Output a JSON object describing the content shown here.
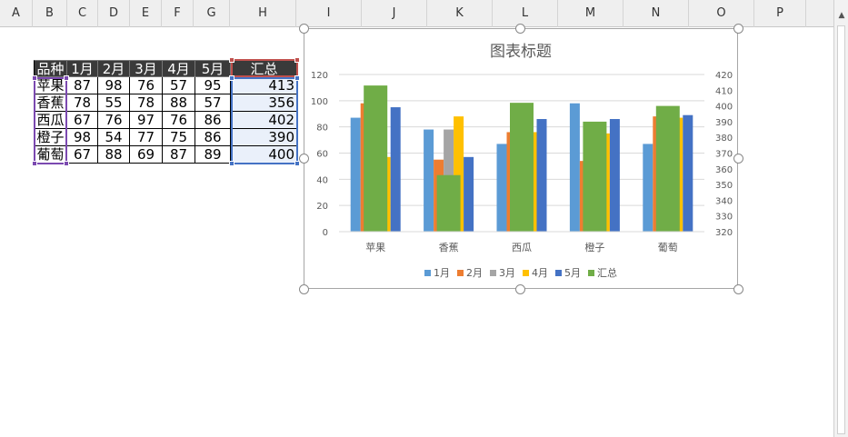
{
  "columns": [
    "A",
    "B",
    "C",
    "D",
    "E",
    "F",
    "G",
    "H",
    "I",
    "J",
    "K",
    "L",
    "M",
    "N",
    "O",
    "P"
  ],
  "table": {
    "headers": [
      "品种",
      "1月",
      "2月",
      "3月",
      "4月",
      "5月",
      "汇总"
    ],
    "rows": [
      {
        "name": "苹果",
        "values": [
          87,
          98,
          76,
          57,
          95
        ],
        "total": 413
      },
      {
        "name": "香蕉",
        "values": [
          78,
          55,
          78,
          88,
          57
        ],
        "total": 356
      },
      {
        "name": "西瓜",
        "values": [
          67,
          76,
          97,
          76,
          86
        ],
        "total": 402
      },
      {
        "name": "橙子",
        "values": [
          98,
          54,
          77,
          75,
          86
        ],
        "total": 390
      },
      {
        "name": "葡萄",
        "values": [
          67,
          88,
          69,
          87,
          89
        ],
        "total": 400
      }
    ]
  },
  "chart_data": {
    "type": "bar",
    "title": "图表标题",
    "categories": [
      "苹果",
      "香蕉",
      "西瓜",
      "橙子",
      "葡萄"
    ],
    "series": [
      {
        "name": "1月",
        "axis": "primary",
        "color": "#5b9bd5",
        "values": [
          87,
          78,
          67,
          98,
          67
        ]
      },
      {
        "name": "2月",
        "axis": "primary",
        "color": "#ed7d31",
        "values": [
          98,
          55,
          76,
          54,
          88
        ]
      },
      {
        "name": "3月",
        "axis": "primary",
        "color": "#a5a5a5",
        "values": [
          76,
          78,
          97,
          77,
          69
        ]
      },
      {
        "name": "4月",
        "axis": "primary",
        "color": "#ffc000",
        "values": [
          57,
          88,
          76,
          75,
          87
        ]
      },
      {
        "name": "5月",
        "axis": "primary",
        "color": "#4472c4",
        "values": [
          95,
          57,
          86,
          86,
          89
        ]
      },
      {
        "name": "汇总",
        "axis": "secondary",
        "color": "#70ad47",
        "values": [
          413,
          356,
          402,
          390,
          400
        ]
      }
    ],
    "ylim": [
      0,
      120
    ],
    "yticks": [
      "0",
      "20",
      "40",
      "60",
      "80",
      "100",
      "120"
    ],
    "y2lim": [
      320,
      420
    ],
    "y2ticks": [
      "320",
      "330",
      "340",
      "350",
      "360",
      "370",
      "380",
      "390",
      "400",
      "410",
      "420"
    ],
    "grid": true,
    "legend": "bottom"
  }
}
